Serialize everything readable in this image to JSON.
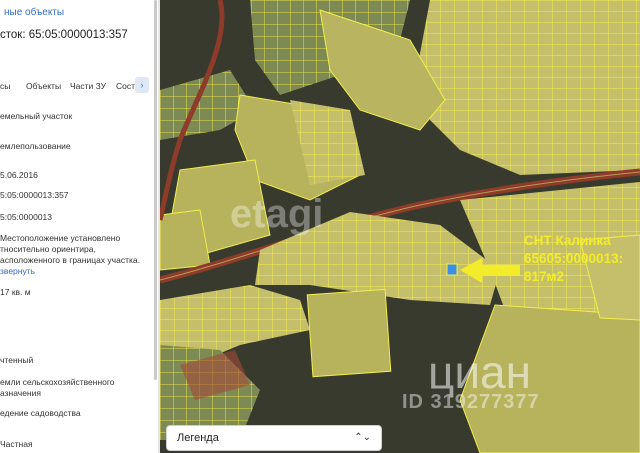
{
  "panel": {
    "breadcrumb": "ные объекты",
    "title": "сток: 65:05:0000013:357",
    "tabs": [
      "сы",
      "Объекты",
      "Части ЗУ",
      "Соста"
    ],
    "rows": [
      {
        "text": "емельный участок"
      },
      {
        "text": "емлепользование"
      },
      {
        "text": "5.06.2016"
      },
      {
        "text": "5:05:0000013:357"
      },
      {
        "text": "5:05:0000013"
      },
      {
        "text": "Местоположение установлено"
      },
      {
        "text": "тносительно ориентира,"
      },
      {
        "text": "асположенного в границах участка."
      },
      {
        "text": "звернуть",
        "link": true
      },
      {
        "text": "17 кв. м"
      },
      {
        "text": "чтенный"
      },
      {
        "text": "емли сельскохозяйственного"
      },
      {
        "text": "азначения"
      },
      {
        "text": "едение садоводства"
      },
      {
        "text": "Частная"
      }
    ]
  },
  "map": {
    "label_lines": [
      "СНТ Калинка",
      "65605:0000013:",
      "817м2"
    ],
    "watermark_etagi": "etagi",
    "watermark_cian": "циан",
    "watermark_id": "ID 319277377",
    "legend_label": "Легенда",
    "colors": {
      "parcel_fill": "#c9c36a",
      "parcel_stroke": "#f3ee4b",
      "arrow": "#f2ec2a",
      "road": "#8e3b2a"
    }
  }
}
